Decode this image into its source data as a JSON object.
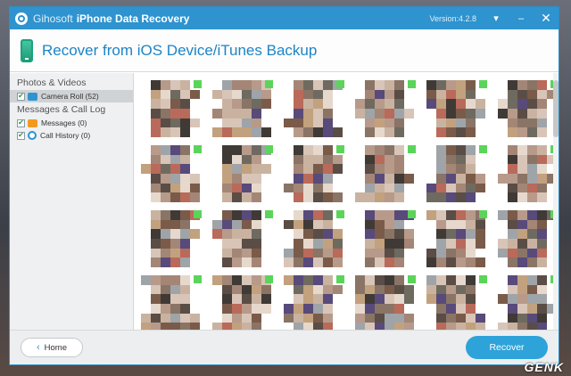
{
  "window": {
    "brand": "Gihosoft",
    "product": "iPhone Data Recovery",
    "version": "Version:4.2.8"
  },
  "header": {
    "title": "Recover from iOS Device/iTunes Backup"
  },
  "sidebar": {
    "categories": [
      {
        "label": "Photos & Videos",
        "items": [
          {
            "label": "Camera Roll (52)",
            "icon": "photo-icon",
            "selected": true
          }
        ]
      },
      {
        "label": "Messages & Call Log",
        "items": [
          {
            "label": "Messages (0)",
            "icon": "message-icon",
            "selected": false
          },
          {
            "label": "Call History (0)",
            "icon": "call-history-icon",
            "selected": false
          }
        ]
      }
    ]
  },
  "footer": {
    "home_label": "Home",
    "recover_label": "Recover"
  },
  "watermark": "GENK",
  "colors": {
    "accent": "#2e93cf",
    "check_badge": "#5bd45a"
  }
}
